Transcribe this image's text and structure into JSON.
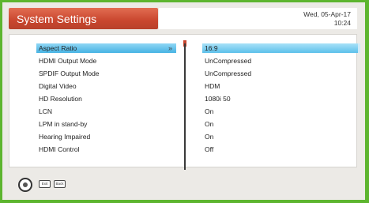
{
  "header": {
    "title": "System Settings",
    "date": "Wed, 05-Apr-17",
    "time": "10:24"
  },
  "settings": [
    {
      "label": "Aspect Ratio",
      "value": "16:9",
      "selected": true
    },
    {
      "label": "HDMI Output Mode",
      "value": "UnCompressed"
    },
    {
      "label": "SPDIF Output Mode",
      "value": "UnCompressed"
    },
    {
      "label": "Digital Video",
      "value": "HDM"
    },
    {
      "label": "HD Resolution",
      "value": "1080i 50"
    },
    {
      "label": "LCN",
      "value": "On"
    },
    {
      "label": "LPM in stand-by",
      "value": "On"
    },
    {
      "label": "Hearing Impaired",
      "value": "On"
    },
    {
      "label": "HDMI Control",
      "value": "Off"
    }
  ],
  "footer": {
    "exit_key": "Exit",
    "back_key": "Back"
  },
  "colors": {
    "accent": "#c9462e",
    "selection": "#47b3e3",
    "border": "#5db52f"
  },
  "icons": {
    "navigation": "dpad-icon",
    "selected_item": "chevron-right-icon"
  }
}
